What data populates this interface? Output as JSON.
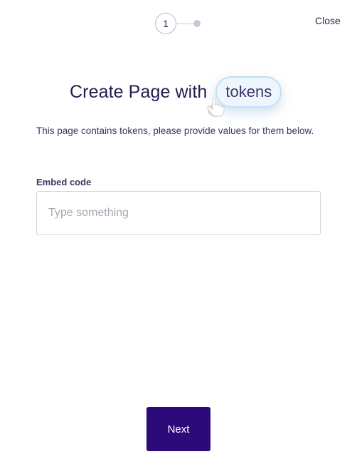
{
  "stepper": {
    "current_step": "1"
  },
  "header": {
    "close_label": "Close"
  },
  "title": {
    "text": "Create Page with",
    "token_label": "tokens"
  },
  "subtitle": "This page contains tokens, please provide values for them below.",
  "form": {
    "embed_code_label": "Embed code",
    "embed_code_value": "",
    "embed_code_placeholder": "Type something"
  },
  "footer": {
    "next_label": "Next"
  },
  "colors": {
    "primary_button": "#2d0a7a",
    "text": "#2b2350",
    "token_pill_bg": "#eef6fd",
    "token_pill_border": "#bfe0f6"
  },
  "icons": {
    "pointer": "hand-pointer-icon"
  }
}
